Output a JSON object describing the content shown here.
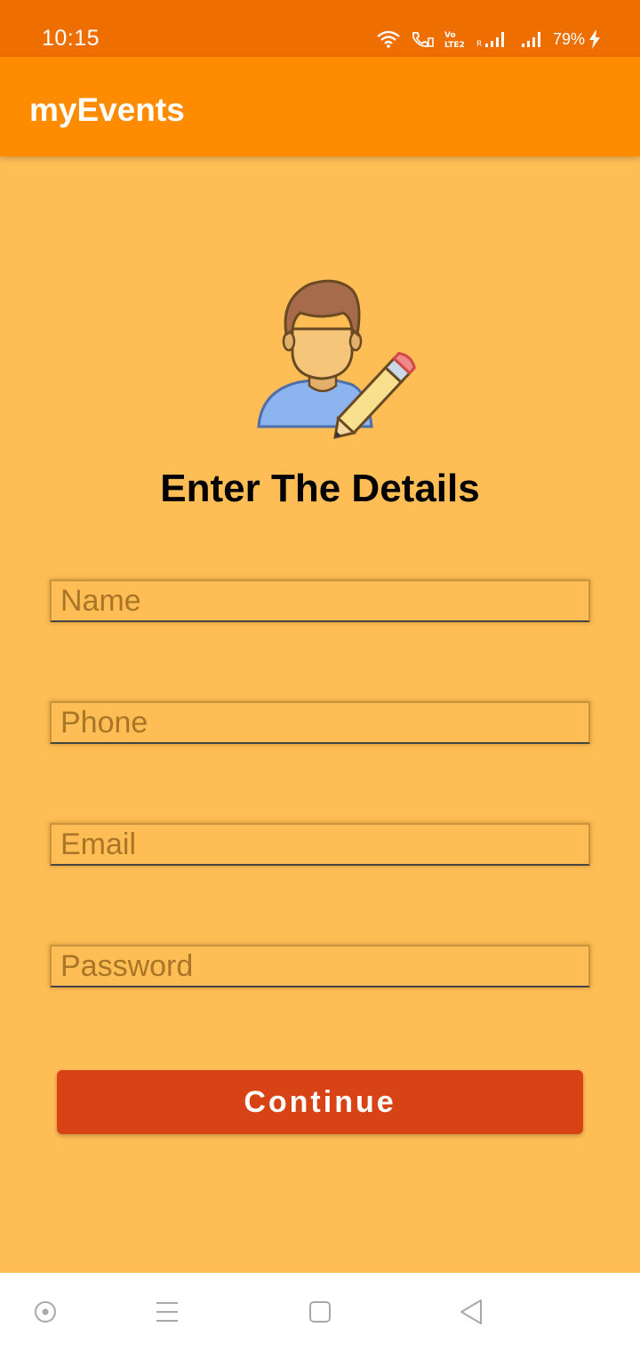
{
  "status_bar": {
    "time": "10:15",
    "battery": "79%",
    "icons": [
      "wifi-icon",
      "wifi-calling-icon",
      "volte-icon",
      "signal-icon",
      "signal-icon",
      "charging-icon"
    ]
  },
  "app_bar": {
    "title": "myEvents"
  },
  "form": {
    "heading": "Enter The Details",
    "illustration": "user-edit-icon",
    "fields": {
      "name": {
        "placeholder": "Name",
        "value": ""
      },
      "phone": {
        "placeholder": "Phone",
        "value": ""
      },
      "email": {
        "placeholder": "Email",
        "value": ""
      },
      "password": {
        "placeholder": "Password",
        "value": ""
      }
    },
    "continue_label": "Continue"
  },
  "nav_bar": {
    "buttons": [
      "assistant-icon",
      "menu-icon",
      "home-square-icon",
      "back-triangle-icon"
    ]
  },
  "colors": {
    "status_bar": "#EE6E00",
    "app_bar": "#FF8C00",
    "background": "#FFBD55",
    "button": "#D84315"
  }
}
